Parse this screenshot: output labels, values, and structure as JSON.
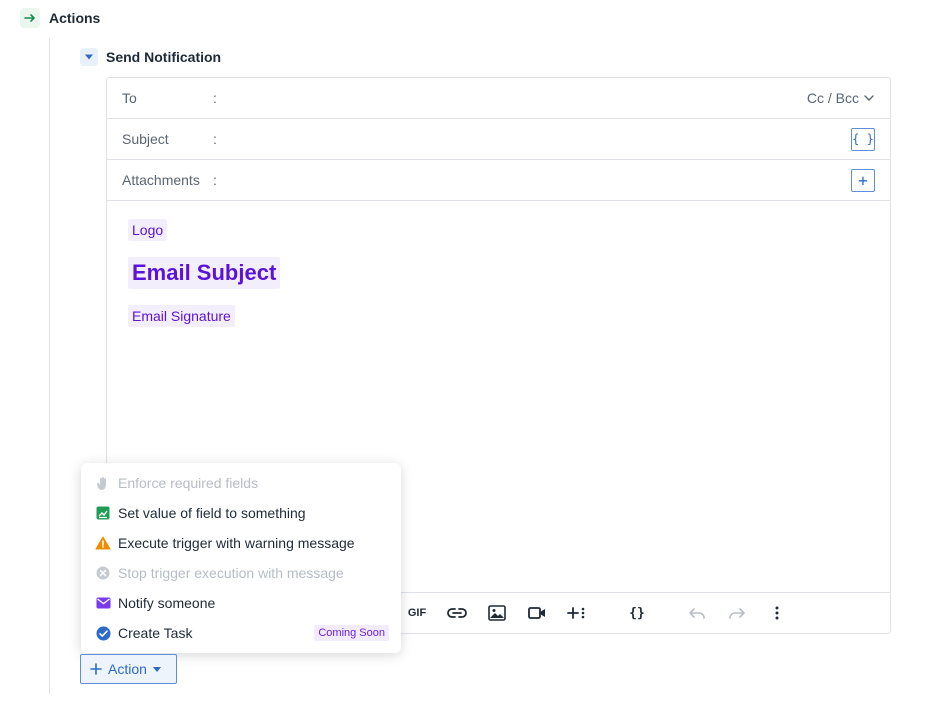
{
  "actions": {
    "title": "Actions"
  },
  "notification": {
    "title": "Send Notification",
    "to_label": "To",
    "subject_label": "Subject",
    "attachments_label": "Attachments",
    "colon": ":",
    "cc_bcc": "Cc / Bcc",
    "variables_btn": "{ }",
    "add_btn": "+"
  },
  "email_body": {
    "logo": "Logo",
    "subject": "Email Subject",
    "signature": "Email Signature"
  },
  "toolbar": {
    "gif": "GIF",
    "icons": [
      "gif-icon",
      "link-icon",
      "image-icon",
      "video-icon",
      "insert-more-icon",
      "code-braces-icon",
      "undo-icon",
      "redo-icon",
      "more-vertical-icon"
    ]
  },
  "menu": {
    "items": [
      {
        "label": "Enforce required fields",
        "icon": "hand-icon",
        "disabled": true
      },
      {
        "label": "Set value of field to something",
        "icon": "set-value-icon",
        "disabled": false
      },
      {
        "label": "Execute trigger with warning message",
        "icon": "warning-icon",
        "disabled": false
      },
      {
        "label": "Stop trigger execution with message",
        "icon": "stop-icon",
        "disabled": true
      },
      {
        "label": "Notify someone",
        "icon": "envelope-icon",
        "disabled": false
      },
      {
        "label": "Create Task",
        "icon": "check-circle-icon",
        "disabled": false,
        "badge": "Coming Soon"
      }
    ]
  },
  "action_button": {
    "label": "Action"
  },
  "colors": {
    "accent": "#2d6bc7",
    "purple": "#5b12d9",
    "green": "#1f8a4c",
    "orange": "#f08c00",
    "border": "#dfe3e8"
  }
}
